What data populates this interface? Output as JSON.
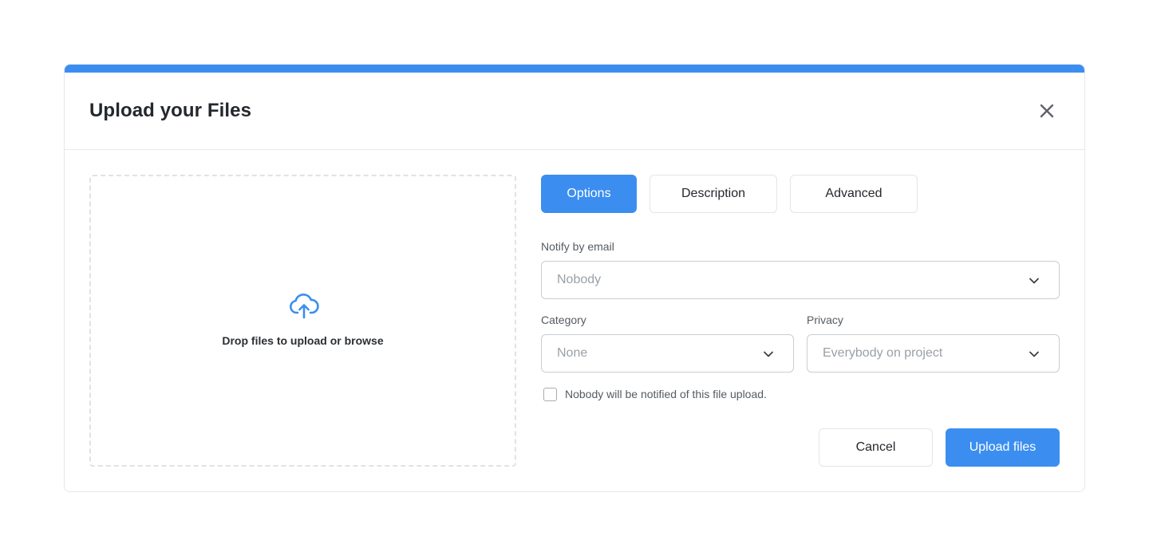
{
  "modal": {
    "title": "Upload your Files",
    "accent_color": "#3b8ef0",
    "close_icon": "close-icon"
  },
  "dropzone": {
    "icon": "cloud-upload-icon",
    "text": "Drop files to upload or browse"
  },
  "tabs": [
    {
      "label": "Options",
      "active": true
    },
    {
      "label": "Description",
      "active": false
    },
    {
      "label": "Advanced",
      "active": false
    }
  ],
  "form": {
    "notify": {
      "label": "Notify by email",
      "value": "Nobody"
    },
    "category": {
      "label": "Category",
      "value": "None"
    },
    "privacy": {
      "label": "Privacy",
      "value": "Everybody on project"
    },
    "checkbox": {
      "label": "Nobody will be notified of this file upload.",
      "checked": false
    }
  },
  "actions": {
    "cancel_label": "Cancel",
    "upload_label": "Upload files"
  }
}
